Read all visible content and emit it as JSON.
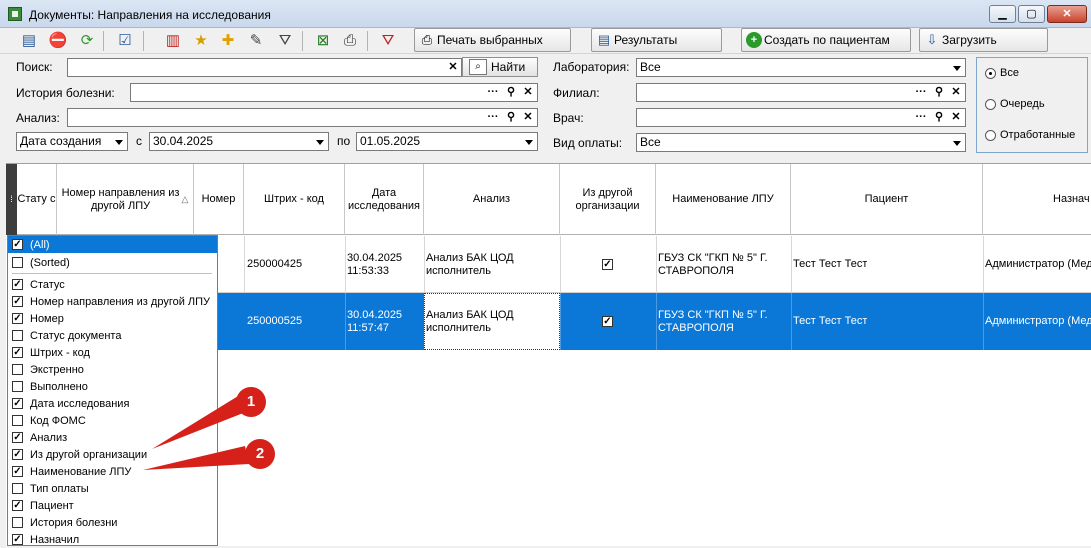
{
  "window": {
    "title": "Документы: Направления на исследования",
    "min": "▁",
    "max": "▢",
    "close": "✕"
  },
  "toolbar": {
    "icons": [
      "edit-doc-icon",
      "stop-icon",
      "refresh-icon",
      "checklist-icon",
      "delete-doc-icon",
      "star-icon",
      "add-icon",
      "edit-list-icon",
      "filter-icon",
      "excel-icon",
      "print-icon",
      "clear-filter-icon"
    ],
    "print_selected": "Печать выбранных",
    "results": "Результаты",
    "create_by_patients": "Создать по пациентам",
    "load": "Загрузить"
  },
  "filters": {
    "search_label": "Поиск:",
    "search_value": "",
    "find_button": "Найти",
    "history_label": "История болезни:",
    "analysis_label": "Анализ:",
    "date_type": "Дата создания",
    "from_label": "с",
    "date_from": "30.04.2025",
    "to_label": "по",
    "date_to": "01.05.2025",
    "lab_label": "Лаборатория:",
    "lab_value": "Все",
    "branch_label": "Филиал:",
    "doctor_label": "Врач:",
    "payment_label": "Вид оплаты:",
    "payment_value": "Все"
  },
  "radio": {
    "options": [
      "Все",
      "Очередь",
      "Отработанные"
    ],
    "selected": "Все"
  },
  "grid": {
    "columns": [
      "Стату с",
      "Номер направления из другой ЛПУ",
      "Номер",
      "Штрих - код",
      "Дата исследования",
      "Анализ",
      "Из другой организации",
      "Наименование ЛПУ",
      "Пациент",
      "Назнач"
    ],
    "rows": [
      {
        "barcode": "250000425",
        "date": "30.04.2025 11:53:33",
        "analysis": "Анализ БАК ЦОД исполнитель",
        "other_org": true,
        "lpu": "ГБУЗ СК \"ГКП № 5\" Г. СТАВРОПОЛЯ",
        "patient": "Тест Тест Тест",
        "assigned": "Администратор (Мед",
        "selected": false
      },
      {
        "barcode": "250000525",
        "date": "30.04.2025 11:57:47",
        "analysis": "Анализ БАК ЦОД исполнитель",
        "other_org": true,
        "lpu": "ГБУЗ СК \"ГКП № 5\" Г. СТАВРОПОЛЯ",
        "patient": "Тест Тест Тест",
        "assigned": "Администратор (Мед",
        "selected": true
      }
    ]
  },
  "column_chooser": {
    "items": [
      {
        "label": "(All)",
        "checked": true
      },
      {
        "label": "(Sorted)",
        "checked": false
      },
      {
        "label": "Статус",
        "checked": true
      },
      {
        "label": "Номер направления из другой ЛПУ",
        "checked": true
      },
      {
        "label": "Номер",
        "checked": true
      },
      {
        "label": "Статус документа",
        "checked": false
      },
      {
        "label": "Штрих - код",
        "checked": true
      },
      {
        "label": "Экстренно",
        "checked": false
      },
      {
        "label": "Выполнено",
        "checked": false
      },
      {
        "label": "Дата исследования",
        "checked": true
      },
      {
        "label": "Код ФОМС",
        "checked": false
      },
      {
        "label": "Анализ",
        "checked": true
      },
      {
        "label": "Из другой организации",
        "checked": true
      },
      {
        "label": "Наименование ЛПУ",
        "checked": true
      },
      {
        "label": "Тип оплаты",
        "checked": false
      },
      {
        "label": "Пациент",
        "checked": true
      },
      {
        "label": "История болезни",
        "checked": false
      },
      {
        "label": "Назначил",
        "checked": true
      }
    ]
  },
  "callouts": [
    "1",
    "2"
  ],
  "colors": {
    "selection": "#0b78d7",
    "callout": "#d6211b"
  }
}
